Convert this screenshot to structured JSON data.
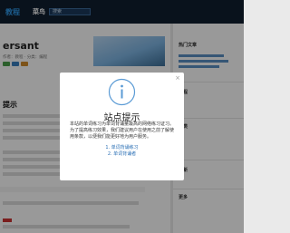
{
  "header": {
    "logo_text": "教程",
    "site_name": "菜鸟",
    "search_placeholder": "搜索"
  },
  "main": {
    "title": "ersant",
    "meta_text": "作者：教程 · 分类：编程",
    "section_heading": "提示"
  },
  "sidebar": {
    "headings": [
      "热门文章",
      "教程",
      "分类",
      "最新",
      "更多"
    ]
  },
  "modal": {
    "title": "站点提示",
    "body": "本站的单词练习为单词背诵量最高的网络练习证习。为了提高练习效果，我们建议用户在使用之前了解使用条款，以便我们能更好地为用户服务。",
    "links": [
      "1. 单词背诵练习",
      "2. 单词背诵者"
    ]
  },
  "colors": {
    "topbar": "#0f1f30",
    "accent": "#2f98e8",
    "link": "#2a6fb5",
    "info_icon": "#5b9bd5"
  }
}
